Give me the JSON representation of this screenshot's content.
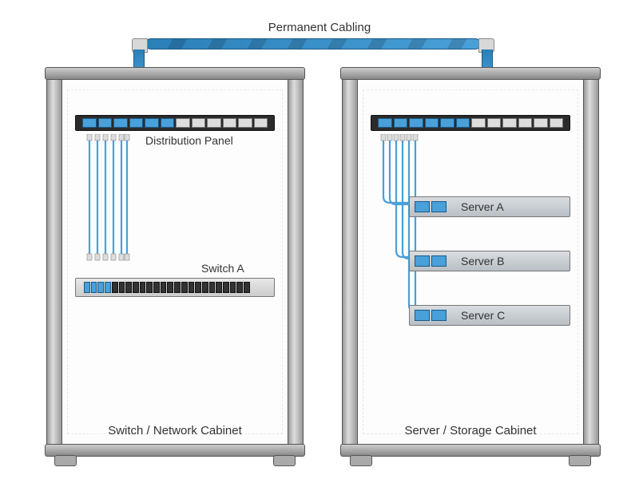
{
  "labels": {
    "permanent_cabling": "Permanent Cabling",
    "distribution_panel": "Distribution Panel",
    "switch_a": "Switch A",
    "server_a": "Server A",
    "server_b": "Server B",
    "server_c": "Server C",
    "left_cabinet": "Switch / Network Cabinet",
    "right_cabinet": "Server / Storage Cabinet"
  },
  "colors": {
    "cable_blue": "#4aa0d8",
    "cable_dark": "#1a5a88",
    "rack_metal": "#999999",
    "server_gray": "#c8ccd0",
    "panel_black": "#2b2b2b"
  },
  "left_cabinet": {
    "patch_panel": {
      "port_count": 12,
      "active_ports": [
        0,
        1,
        2,
        3,
        4,
        5
      ]
    },
    "switch": {
      "port_count": 24,
      "blue_ports": [
        0,
        1,
        2,
        3
      ]
    }
  },
  "right_cabinet": {
    "patch_panel": {
      "port_count": 12,
      "active_ports": [
        0,
        1,
        2,
        3,
        4,
        5
      ]
    },
    "servers": [
      "server_a",
      "server_b",
      "server_c"
    ]
  }
}
